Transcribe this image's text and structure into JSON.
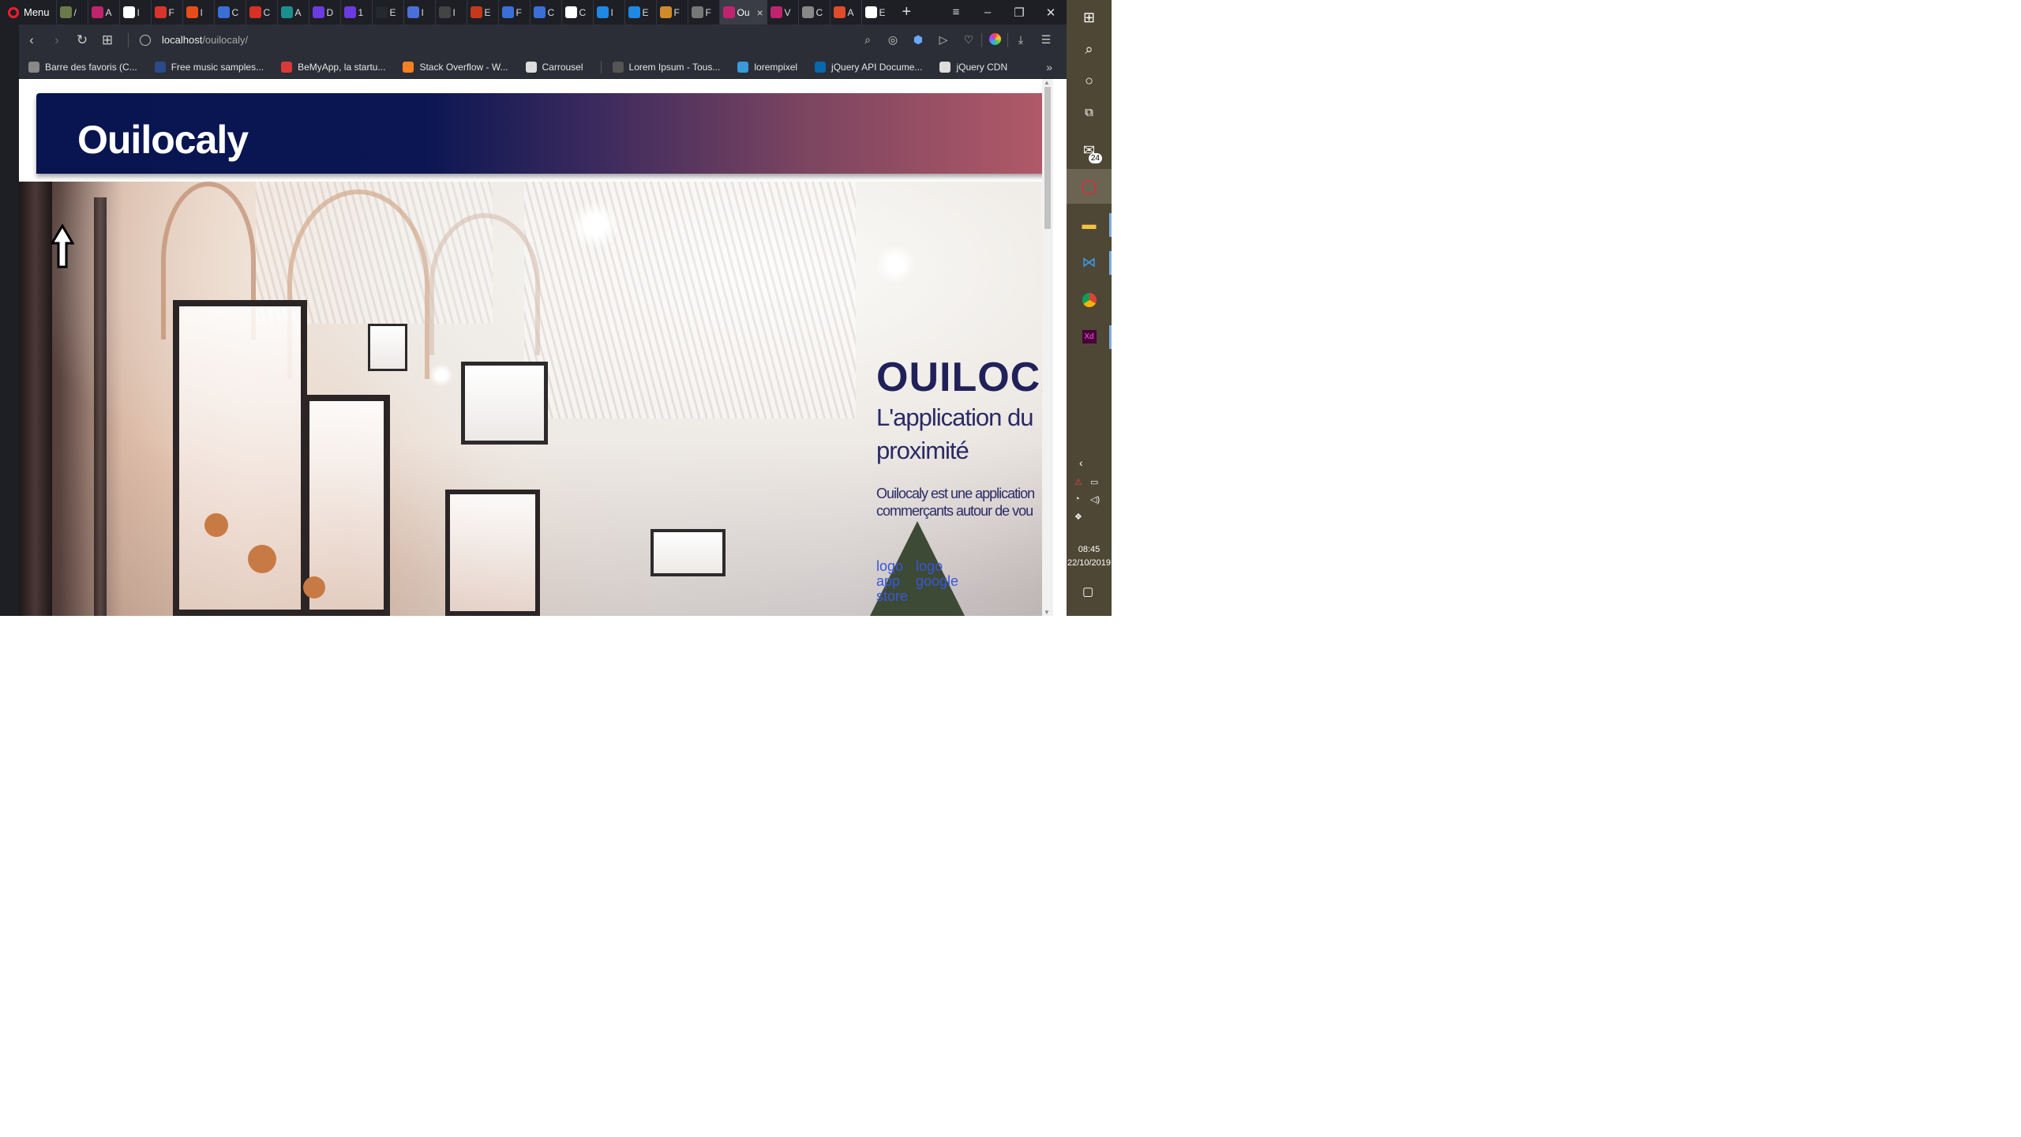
{
  "browser": {
    "menu_label": "Menu",
    "tabs": [
      {
        "letter": "/",
        "color": "#6b7a4a"
      },
      {
        "letter": "A",
        "color": "#c0246f"
      },
      {
        "letter": "I",
        "color": "#ffffff"
      },
      {
        "letter": "F",
        "color": "#d9342b"
      },
      {
        "letter": "I",
        "color": "#e84c1b"
      },
      {
        "letter": "C",
        "color": "#3a6fd8"
      },
      {
        "letter": "C",
        "color": "#d93025"
      },
      {
        "letter": "A",
        "color": "#1a8f8f"
      },
      {
        "letter": "D",
        "color": "#6b3be0"
      },
      {
        "letter": "1",
        "color": "#6b3be0"
      },
      {
        "letter": "E",
        "color": "#24292e"
      },
      {
        "letter": "I",
        "color": "#4a6fd8"
      },
      {
        "letter": "I",
        "color": "#444444"
      },
      {
        "letter": "E",
        "color": "#c4391a"
      },
      {
        "letter": "F",
        "color": "#3a6fd8"
      },
      {
        "letter": "C",
        "color": "#3a6fd8"
      },
      {
        "letter": "C",
        "color": "#ffffff"
      },
      {
        "letter": "I",
        "color": "#1e88e5"
      },
      {
        "letter": "E",
        "color": "#1e88e5"
      },
      {
        "letter": "F",
        "color": "#d08a2a"
      },
      {
        "letter": "F",
        "color": "#777777"
      }
    ],
    "active_tab": {
      "label": "Ou",
      "color": "#c0246f"
    },
    "tabs_after": [
      {
        "letter": "V",
        "color": "#c0246f"
      },
      {
        "letter": "C",
        "color": "#888888"
      },
      {
        "letter": "A",
        "color": "#e04b2a"
      },
      {
        "letter": "E",
        "color": "#ffffff"
      }
    ],
    "url_host": "localhost",
    "url_path": "/ouilocaly/",
    "bookmarks": [
      {
        "label": "Barre des favoris (C...",
        "color": "#888888"
      },
      {
        "label": "Free music samples...",
        "color": "#2a4a8a"
      },
      {
        "label": "BeMyApp, la startu...",
        "color": "#d83a3a"
      },
      {
        "label": "Stack Overflow - W...",
        "color": "#f48024"
      },
      {
        "label": "Carrousel",
        "color": "#dddddd"
      },
      {
        "label": "Lorem Ipsum - Tous...",
        "color": "#555555"
      },
      {
        "label": "lorempixel",
        "color": "#3a9ad9"
      },
      {
        "label": "jQuery API Docume...",
        "color": "#0769ad"
      },
      {
        "label": "jQuery CDN",
        "color": "#dddddd"
      }
    ],
    "bookmarks_more": "»"
  },
  "page": {
    "site_title": "Ouilocaly",
    "hero_heading": "OUILOCA",
    "hero_subheading": "L'application du proximité",
    "hero_description": "Ouilocaly est une application commerçants autour de vou",
    "store_links": {
      "app_store_alt": "logo app store",
      "google_alt": "logo google"
    },
    "colors": {
      "header_start": "#081550",
      "header_end": "#b35a68",
      "heading": "#21215a",
      "link": "#3a57d8"
    }
  },
  "taskbar": {
    "mail_badge": "24",
    "time": "08:45",
    "date": "22/10/2019",
    "apps": [
      "windows-icon",
      "search-icon",
      "cortana-icon",
      "task-view-icon",
      "mail-icon",
      "opera-icon",
      "file-explorer-icon",
      "vscode-icon",
      "chrome-icon",
      "adobe-xd-icon"
    ]
  }
}
